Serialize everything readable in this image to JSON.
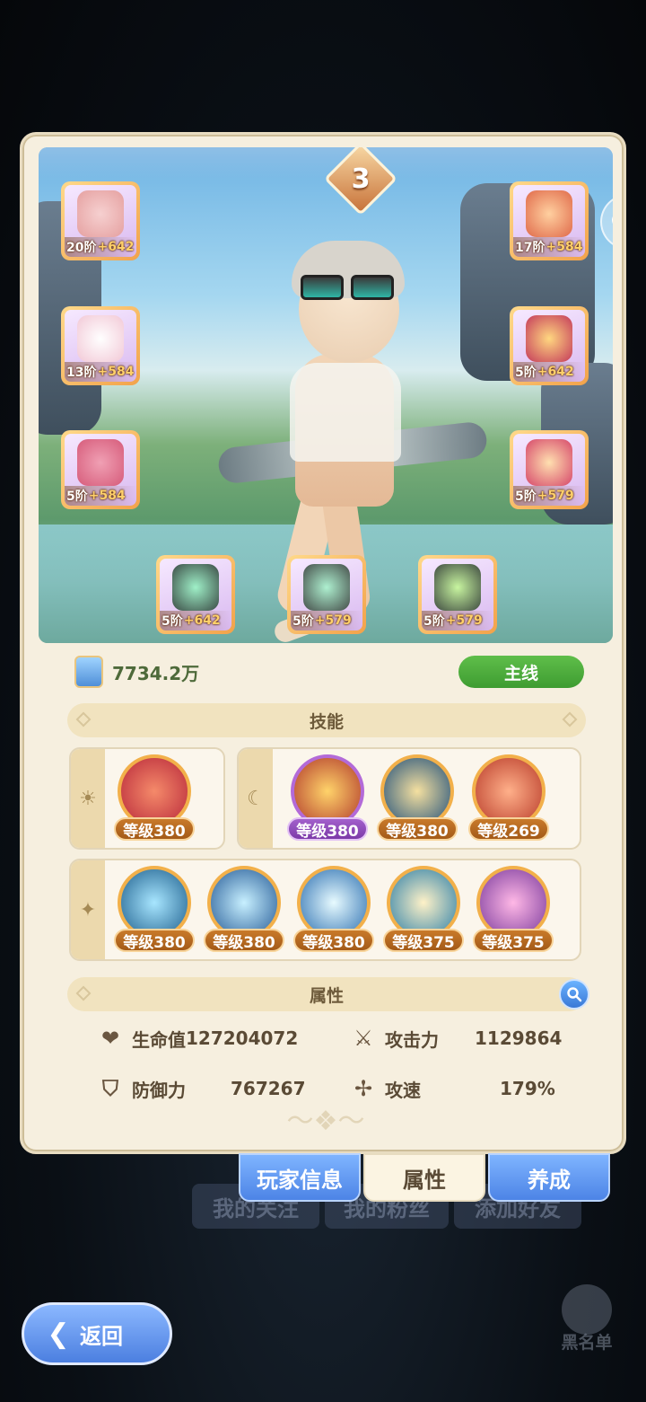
{
  "background": {
    "ghost_buttons": [
      "我的关注",
      "我的粉丝",
      "添加好友"
    ],
    "blacklist_label": "黑名单",
    "back_label": "返回"
  },
  "rank": "3",
  "equipment": [
    {
      "id": "bow",
      "tier": "20阶",
      "bonus": "+642",
      "icon": "bow-icon",
      "color": "#e5a0a0"
    },
    {
      "id": "armor",
      "tier": "13阶",
      "bonus": "+584",
      "icon": "armor-icon",
      "color": "#f2c8d6"
    },
    {
      "id": "belt",
      "tier": "5阶",
      "bonus": "+584",
      "icon": "belt-icon",
      "color": "#d65b7a"
    },
    {
      "id": "helmet",
      "tier": "17阶",
      "bonus": "+584",
      "icon": "helmet-icon",
      "color": "#e06a4a"
    },
    {
      "id": "bracer",
      "tier": "5阶",
      "bonus": "+642",
      "icon": "bracer-icon",
      "color": "#c43a5a"
    },
    {
      "id": "boots",
      "tier": "5阶",
      "bonus": "+579",
      "icon": "boots-icon",
      "color": "#d6476a"
    },
    {
      "id": "ring",
      "tier": "5阶",
      "bonus": "+642",
      "icon": "ring-icon",
      "color": "#3aa87a"
    },
    {
      "id": "necklace",
      "tier": "5阶",
      "bonus": "+579",
      "icon": "necklace-icon",
      "color": "#4a9c7a"
    },
    {
      "id": "amulet",
      "tier": "5阶",
      "bonus": "+579",
      "icon": "amulet-icon",
      "color": "#5ab888"
    }
  ],
  "power": {
    "value": "7734.2万",
    "mode_button": "主线"
  },
  "skills": {
    "title": "技能",
    "sun_group": [
      {
        "level": "等级380",
        "color": "#d9453a",
        "icon": "claw-skill-icon"
      }
    ],
    "moon_group": [
      {
        "level": "等级380",
        "color": "#d0612a",
        "icon": "star-burst-skill-icon",
        "purple": true
      },
      {
        "level": "等级380",
        "color": "#2f6f9e",
        "icon": "figure-skill-icon"
      },
      {
        "level": "等级269",
        "color": "#d25a38",
        "icon": "arrow-skill-icon"
      }
    ],
    "star_group": [
      {
        "level": "等级380",
        "color": "#2a86b5",
        "icon": "wings-skill-icon"
      },
      {
        "level": "等级380",
        "color": "#3b7cc4",
        "icon": "vortex-skill-icon"
      },
      {
        "level": "等级380",
        "color": "#3a8fd1",
        "icon": "dash-skill-icon"
      },
      {
        "level": "等级375",
        "color": "#3aa1c8",
        "icon": "heart-skill-icon"
      },
      {
        "level": "等级375",
        "color": "#a554c4",
        "icon": "target-skill-icon"
      }
    ]
  },
  "attributes": {
    "title": "属性",
    "hp": {
      "label": "生命值",
      "value": "127204072"
    },
    "attack": {
      "label": "攻击力",
      "value": "1129864"
    },
    "defense": {
      "label": "防御力",
      "value": "767267"
    },
    "speed": {
      "label": "攻速",
      "value": "179%"
    }
  },
  "tabs": [
    "玩家信息",
    "属性",
    "养成"
  ]
}
